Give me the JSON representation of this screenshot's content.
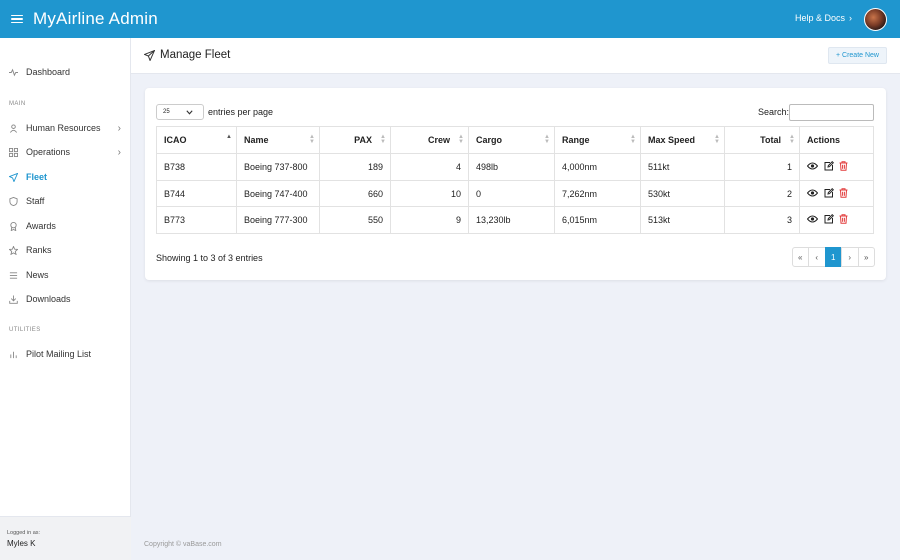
{
  "app": {
    "title": "MyAirline Admin",
    "help_label": "Help & Docs",
    "help_chevron": "›"
  },
  "sidebar": {
    "dashboard": "Dashboard",
    "section_main": "MAIN",
    "items": [
      {
        "label": "Human Resources",
        "has_chevron": true
      },
      {
        "label": "Operations",
        "has_chevron": true
      },
      {
        "label": "Fleet"
      },
      {
        "label": "Staff"
      },
      {
        "label": "Awards"
      },
      {
        "label": "Ranks"
      },
      {
        "label": "News"
      },
      {
        "label": "Downloads"
      }
    ],
    "section_utilities": "UTILITIES",
    "utilities": [
      {
        "label": "Pilot Mailing List"
      }
    ],
    "chevron": "›",
    "login": {
      "caption": "Logged in as:",
      "user": "Myles K"
    }
  },
  "page": {
    "title": "Manage Fleet",
    "create_label": "+ Create New"
  },
  "table_controls": {
    "length_value": "25",
    "length_suffix": "entries per page",
    "search_label": "Search:",
    "search_value": ""
  },
  "table": {
    "columns": [
      "ICAO",
      "Name",
      "PAX",
      "Crew",
      "Cargo",
      "Range",
      "Max Speed",
      "Total",
      "Actions"
    ],
    "rows": [
      [
        "B738",
        "Boeing 737-800",
        "189",
        "4",
        "498lb",
        "4,000nm",
        "511kt",
        "1"
      ],
      [
        "B744",
        "Boeing 747-400",
        "660",
        "10",
        "0",
        "7,262nm",
        "530kt",
        "2"
      ],
      [
        "B773",
        "Boeing 777-300",
        "550",
        "9",
        "13,230lb",
        "6,015nm",
        "513kt",
        "3"
      ]
    ],
    "info": "Showing 1 to 3 of 3 entries"
  },
  "pagination": {
    "first": "«",
    "prev": "‹",
    "page": "1",
    "next": "›",
    "last": "»"
  },
  "footer": "Copyright © vaBase.com",
  "colors": {
    "primary": "#1f96cf",
    "danger": "#e23b3b",
    "background": "#eef1f8"
  },
  "icons": {
    "dashboard": "pulse-icon",
    "hr": "user-icon",
    "operations": "grid-icon",
    "fleet": "send-icon",
    "staff": "shield-icon",
    "awards": "award-icon",
    "ranks": "star-icon",
    "news": "list-icon",
    "downloads": "download-icon",
    "mailing": "bar-chart-icon",
    "view": "eye-icon",
    "edit": "edit-icon",
    "delete": "trash-icon"
  }
}
